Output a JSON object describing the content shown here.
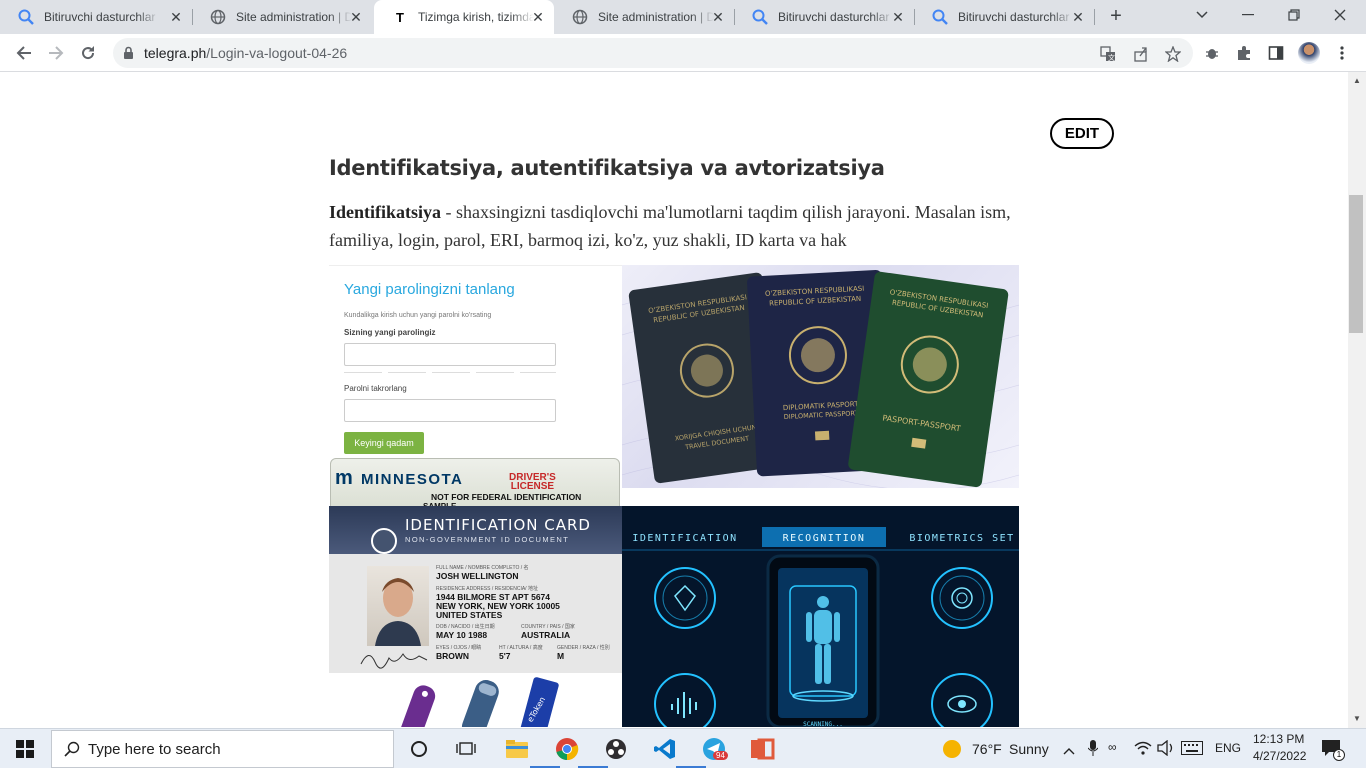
{
  "browser": {
    "tabs": [
      {
        "title": "Bitiruvchi dasturchlar",
        "icon": "search-icon",
        "active": false
      },
      {
        "title": "Site administration | D",
        "icon": "globe-icon",
        "active": false
      },
      {
        "title": "Tizimga kirish, tizimdan",
        "icon": "telegraph-icon",
        "active": true
      },
      {
        "title": "Site administration | D",
        "icon": "globe-icon",
        "active": false
      },
      {
        "title": "Bitiruvchi dasturchlar",
        "icon": "search-icon",
        "active": false
      },
      {
        "title": "Bitiruvchi dasturchlar",
        "icon": "search-icon",
        "active": false
      }
    ],
    "new_tab_label": "+",
    "address": {
      "host": "telegra.ph",
      "path": "/Login-va-logout-04-26"
    }
  },
  "article": {
    "edit_label": "EDIT",
    "heading": "Identifikatsiya, autentifikatsiya va avtorizatsiya",
    "para_term": "Identifikatsiya",
    "para_text": " - shaxsingizni tasdiqlovchi ma'lumotlarni taqdim qilish jarayoni. Masalan ism, familiya, login, parol, ERI, barmoq izi, ko'z, yuz shakli, ID karta va hak"
  },
  "collage": {
    "form": {
      "title": "Yangi parolingizni tanlang",
      "hint": "Kundalikga kirish uchun yangi parolni ko'rsating",
      "field1_label": "Sizning yangi parolingiz",
      "field2_label": "Parolni takrorlang",
      "button_label": "Keyingi qadam"
    },
    "passports": [
      {
        "country": "O'ZBEKISTON RESPUBLIKASI",
        "country_en": "REPUBLIC OF UZBEKISTAN",
        "type": "XORIJGA CHIQISH UCHUN",
        "type2": "TRAVEL DOCUMENT",
        "color": "#232b33"
      },
      {
        "country": "O'ZBEKISTON RESPUBLIKASI",
        "country_en": "REPUBLIC OF UZBEKISTAN",
        "type": "DIPLOMATIK PASPORT",
        "type2": "DIPLOMATIC PASSPORT",
        "color": "#1c2240"
      },
      {
        "country": "O'ZBEKISTON RESPUBLIKASI",
        "country_en": "REPUBLIC OF UZBEKISTAN",
        "type": "PASPORT-PASSPORT",
        "type2": "",
        "color": "#1f4a2e"
      }
    ],
    "mn_license": {
      "state": "MINNESOTA",
      "kind1": "DRIVER'S",
      "kind2": "LICENSE",
      "note": "NOT FOR FEDERAL IDENTIFICATION",
      "sample": "SAMPLE"
    },
    "id_card": {
      "title": "IDENTIFICATION CARD",
      "subtitle": "NON-GOVERNMENT ID DOCUMENT",
      "name_label": "FULL NAME / NOMBRE COMPLETO / 名",
      "name": "JOSH WELLINGTON",
      "addr_label": "RESIDENCE ADDRESS / RESIDENCIA/ 地址",
      "addr1": "1944 BILMORE ST APT 5674",
      "addr2": "NEW YORK, NEW YORK 10005",
      "addr3": "UNITED STATES",
      "dob_label": "DOB / NACIDO / 出生日期",
      "dob": "MAY 10 1988",
      "country_label": "COUNTRY / PAIS / 国家",
      "country": "AUSTRALIA",
      "eyes_label": "EYES / OJOS / 眼睛",
      "eyes": "BROWN",
      "ht_label": "HT / ALTURA / 高度",
      "ht": "5'7",
      "gender_label": "GENDER / RAZA / 性別",
      "gender": "M"
    },
    "token_label": "eToken",
    "biometric": {
      "tabs": [
        "IDENTIFICATION",
        "RECOGNITION",
        "BIOMETRICS SET"
      ],
      "scanning": "SCANNING..."
    }
  },
  "taskbar": {
    "search_placeholder": "Type here to search",
    "telegram_badge": "94",
    "weather_temp": "76°F",
    "weather_desc": "Sunny",
    "lang": "ENG",
    "time": "12:13 PM",
    "date": "4/27/2022",
    "notif_count": "1"
  },
  "colors": {
    "accent_blue": "#1a73e8",
    "form_title": "#29a8df",
    "button_green": "#7cb342",
    "bio_bg": "#061a33"
  }
}
